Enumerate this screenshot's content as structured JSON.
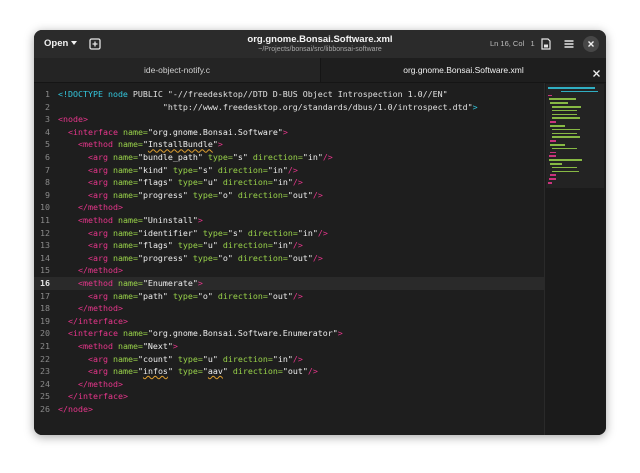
{
  "header": {
    "open_label": "Open",
    "title": "org.gnome.Bonsai.Software.xml",
    "subtitle": "~/Projects/bonsai/src/libbonsai-software",
    "position": "Ln 16, Col   1"
  },
  "tabs": [
    {
      "label": "ide-object-notify.c",
      "active": false
    },
    {
      "label": "org.gnome.Bonsai.Software.xml",
      "active": true
    }
  ],
  "current_line": 16,
  "lines": [
    {
      "n": "1",
      "html": "<span class=\"doc\">&lt;!DOCTYPE node</span> PUBLIC \"-//freedesktop//DTD D-BUS Object Introspection 1.0//EN\""
    },
    {
      "n": "2",
      "html": "                     \"http://www.freedesktop.org/standards/dbus/1.0/introspect.dtd\"<span class=\"doc\">&gt;</span>"
    },
    {
      "n": "3",
      "html": "<span class=\"tag\">&lt;node&gt;</span>"
    },
    {
      "n": "4",
      "html": "  <span class=\"tag\">&lt;interface</span> <span class=\"attr\">name=</span><span class=\"str\">\"org.gnome.Bonsai.Software\"</span><span class=\"tag\">&gt;</span>"
    },
    {
      "n": "5",
      "html": "    <span class=\"tag\">&lt;method</span> <span class=\"attr\">name=</span><span class=\"str\">\"<span class=\"und\">InstallBundle</span>\"</span><span class=\"tag\">&gt;</span>"
    },
    {
      "n": "6",
      "html": "      <span class=\"tag\">&lt;arg</span> <span class=\"attr\">name=</span><span class=\"str\">\"bundle_path\"</span> <span class=\"attr\">type=</span><span class=\"str\">\"s\"</span> <span class=\"attr\">direction=</span><span class=\"str\">\"in\"</span><span class=\"tag\">/&gt;</span>"
    },
    {
      "n": "7",
      "html": "      <span class=\"tag\">&lt;arg</span> <span class=\"attr\">name=</span><span class=\"str\">\"kind\"</span> <span class=\"attr\">type=</span><span class=\"str\">\"s\"</span> <span class=\"attr\">direction=</span><span class=\"str\">\"in\"</span><span class=\"tag\">/&gt;</span>"
    },
    {
      "n": "8",
      "html": "      <span class=\"tag\">&lt;arg</span> <span class=\"attr\">name=</span><span class=\"str\">\"flags\"</span> <span class=\"attr\">type=</span><span class=\"str\">\"u\"</span> <span class=\"attr\">direction=</span><span class=\"str\">\"in\"</span><span class=\"tag\">/&gt;</span>"
    },
    {
      "n": "9",
      "html": "      <span class=\"tag\">&lt;arg</span> <span class=\"attr\">name=</span><span class=\"str\">\"progress\"</span> <span class=\"attr\">type=</span><span class=\"str\">\"o\"</span> <span class=\"attr\">direction=</span><span class=\"str\">\"out\"</span><span class=\"tag\">/&gt;</span>"
    },
    {
      "n": "10",
      "html": "    <span class=\"tag\">&lt;/method&gt;</span>"
    },
    {
      "n": "11",
      "html": "    <span class=\"tag\">&lt;method</span> <span class=\"attr\">name=</span><span class=\"str\">\"Uninstall\"</span><span class=\"tag\">&gt;</span>"
    },
    {
      "n": "12",
      "html": "      <span class=\"tag\">&lt;arg</span> <span class=\"attr\">name=</span><span class=\"str\">\"identifier\"</span> <span class=\"attr\">type=</span><span class=\"str\">\"s\"</span> <span class=\"attr\">direction=</span><span class=\"str\">\"in\"</span><span class=\"tag\">/&gt;</span>"
    },
    {
      "n": "13",
      "html": "      <span class=\"tag\">&lt;arg</span> <span class=\"attr\">name=</span><span class=\"str\">\"flags\"</span> <span class=\"attr\">type=</span><span class=\"str\">\"u\"</span> <span class=\"attr\">direction=</span><span class=\"str\">\"in\"</span><span class=\"tag\">/&gt;</span>"
    },
    {
      "n": "14",
      "html": "      <span class=\"tag\">&lt;arg</span> <span class=\"attr\">name=</span><span class=\"str\">\"progress\"</span> <span class=\"attr\">type=</span><span class=\"str\">\"o\"</span> <span class=\"attr\">direction=</span><span class=\"str\">\"out\"</span><span class=\"tag\">/&gt;</span>"
    },
    {
      "n": "15",
      "html": "    <span class=\"tag\">&lt;/method&gt;</span>"
    },
    {
      "n": "16",
      "html": "    <span class=\"tag\">&lt;method</span> <span class=\"attr\">name=</span><span class=\"str\">\"Enumerate\"</span><span class=\"tag\">&gt;</span>"
    },
    {
      "n": "17",
      "html": "      <span class=\"tag\">&lt;arg</span> <span class=\"attr\">name=</span><span class=\"str\">\"path\"</span> <span class=\"attr\">type=</span><span class=\"str\">\"o\"</span> <span class=\"attr\">direction=</span><span class=\"str\">\"out\"</span><span class=\"tag\">/&gt;</span>"
    },
    {
      "n": "18",
      "html": "    <span class=\"tag\">&lt;/method&gt;</span>"
    },
    {
      "n": "19",
      "html": "  <span class=\"tag\">&lt;/interface&gt;</span>"
    },
    {
      "n": "20",
      "html": "  <span class=\"tag\">&lt;interface</span> <span class=\"attr\">name=</span><span class=\"str\">\"org.gnome.Bonsai.Software.Enumerator\"</span><span class=\"tag\">&gt;</span>"
    },
    {
      "n": "21",
      "html": "    <span class=\"tag\">&lt;method</span> <span class=\"attr\">name=</span><span class=\"str\">\"Next\"</span><span class=\"tag\">&gt;</span>"
    },
    {
      "n": "22",
      "html": "      <span class=\"tag\">&lt;arg</span> <span class=\"attr\">name=</span><span class=\"str\">\"count\"</span> <span class=\"attr\">type=</span><span class=\"str\">\"u\"</span> <span class=\"attr\">direction=</span><span class=\"str\">\"in\"</span><span class=\"tag\">/&gt;</span>"
    },
    {
      "n": "23",
      "html": "      <span class=\"tag\">&lt;arg</span> <span class=\"attr\">name=</span><span class=\"str\">\"<span class=\"und\">infos</span>\"</span> <span class=\"attr\">type=</span><span class=\"str\">\"<span class=\"und\">aav</span>\"</span> <span class=\"attr\">direction=</span><span class=\"str\">\"out\"</span><span class=\"tag\">/&gt;</span>"
    },
    {
      "n": "24",
      "html": "    <span class=\"tag\">&lt;/method&gt;</span>"
    },
    {
      "n": "25",
      "html": "  <span class=\"tag\">&lt;/interface&gt;</span>"
    },
    {
      "n": "26",
      "html": "<span class=\"tag\">&lt;/node&gt;</span>"
    }
  ],
  "colors": {
    "tag": "#e8368c",
    "attr": "#99d34a",
    "string": "#eeeeee",
    "doctype": "#33c7de",
    "background": "#1e1e1e"
  },
  "icons": {
    "new_tab": "new-tab-icon",
    "save": "save-icon",
    "menu": "hamburger-menu-icon",
    "close": "close-icon"
  }
}
